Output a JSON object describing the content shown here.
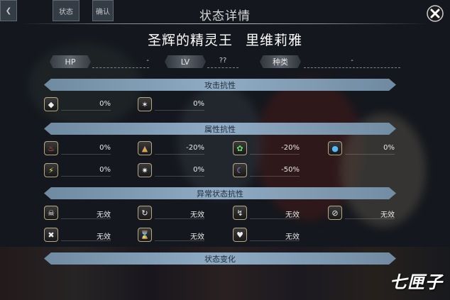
{
  "top_tabs": [
    "状态",
    "确认"
  ],
  "title": "状态详情",
  "character": {
    "title": "圣辉的精灵王",
    "name": "里维莉雅"
  },
  "stats": [
    {
      "label": "HP",
      "value": "-"
    },
    {
      "label": "LV",
      "value": "??"
    },
    {
      "label": "种类",
      "value": "-"
    }
  ],
  "sections": {
    "attack": "攻击抗性",
    "attribute": "属性抗性",
    "status": "异常状态抗性",
    "change": "状态变化"
  },
  "attack_resist": [
    {
      "icon": "shield-guard-icon",
      "value": "0%"
    },
    {
      "icon": "magic-guard-icon",
      "value": "0%"
    }
  ],
  "attribute_resist": [
    {
      "icon": "fire-icon",
      "value": "0%"
    },
    {
      "icon": "earth-icon",
      "value": "-20%"
    },
    {
      "icon": "wind-icon",
      "value": "-20%"
    },
    {
      "icon": "water-icon",
      "value": "0%"
    },
    {
      "icon": "thunder-icon",
      "value": "0%"
    },
    {
      "icon": "light-icon",
      "value": "0%"
    },
    {
      "icon": "dark-icon",
      "value": "-50%"
    }
  ],
  "status_resist": [
    {
      "icon": "poison-icon",
      "value": "无效"
    },
    {
      "icon": "sleep-icon",
      "value": "无效"
    },
    {
      "icon": "paralysis-icon",
      "value": "无效"
    },
    {
      "icon": "seal-icon",
      "value": "无效"
    },
    {
      "icon": "stun-icon",
      "value": "无效"
    },
    {
      "icon": "slow-icon",
      "value": "无效"
    },
    {
      "icon": "charm-icon",
      "value": "无效"
    }
  ],
  "watermark": "七匣子",
  "colors": {
    "section_bar": "#93b4cf",
    "icon_border": "#b9a884",
    "overlay": "#0a0c10"
  }
}
